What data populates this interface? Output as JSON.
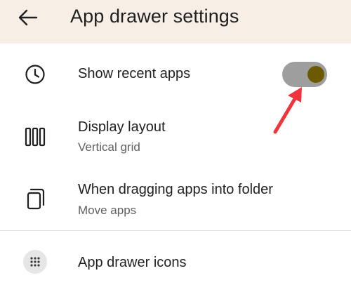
{
  "header": {
    "title": "App drawer settings",
    "background": "#f7efe6"
  },
  "rows": [
    {
      "title": "Show recent apps",
      "icon": "clock-icon",
      "toggle": {
        "on": true
      }
    },
    {
      "title": "Display layout",
      "subtitle": "Vertical grid",
      "icon": "columns-icon"
    },
    {
      "title": "When dragging apps into folder",
      "subtitle": "Move apps",
      "icon": "copy-icon"
    },
    {
      "title": "App drawer icons",
      "icon": "dots-grid-icon"
    }
  ],
  "colors": {
    "toggle_track": "#9e9e9e",
    "toggle_knob": "#6b5a00",
    "annotation_arrow": "#f0343c",
    "divider": "#e3e3e3"
  }
}
